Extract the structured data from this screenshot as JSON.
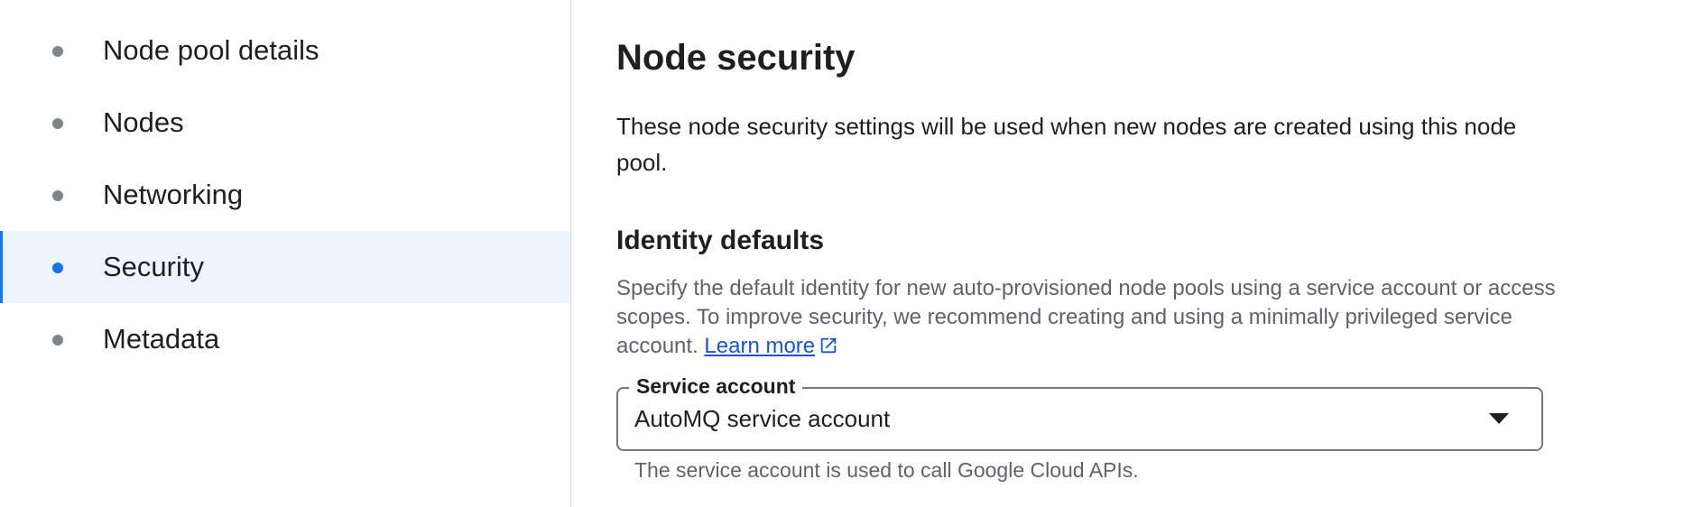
{
  "sidebar": {
    "items": [
      {
        "label": "Node pool details",
        "active": false
      },
      {
        "label": "Nodes",
        "active": false
      },
      {
        "label": "Networking",
        "active": false
      },
      {
        "label": "Security",
        "active": true
      },
      {
        "label": "Metadata",
        "active": false
      }
    ]
  },
  "main": {
    "title": "Node security",
    "intro": "These node security settings will be used when new nodes are created using this node pool.",
    "identity": {
      "title": "Identity defaults",
      "description": "Specify the default identity for new auto-provisioned node pools using a service account or access scopes. To improve security, we recommend creating and using a minimally privileged service account.",
      "learn_more": "Learn more",
      "learn_more_icon": "external-link-icon"
    },
    "service_account": {
      "label": "Service account",
      "value": "AutoMQ service account",
      "hint": "The service account is used to call Google Cloud APIs.",
      "icon": "dropdown-arrow-icon"
    }
  },
  "colors": {
    "accent": "#1a73e8",
    "active_bg": "#eef4fe",
    "muted_text": "#5f6368",
    "link": "#1a57c4"
  }
}
